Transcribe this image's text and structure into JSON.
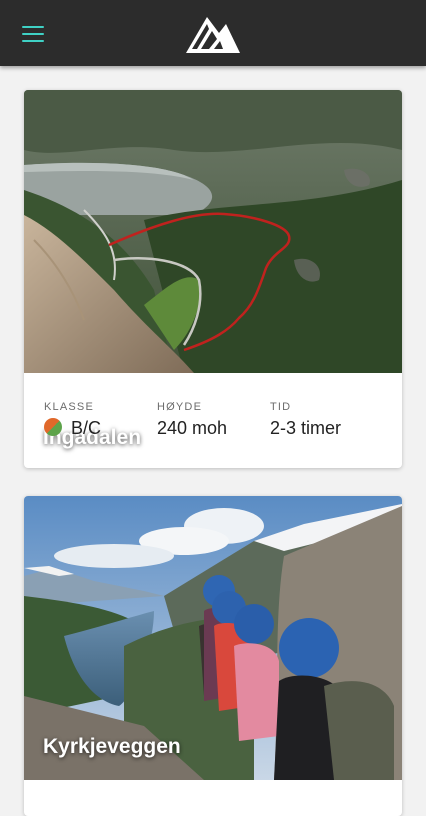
{
  "header": {
    "menu_icon": "hamburger-menu-icon",
    "logo_icon": "mountain-logo-icon",
    "accent_color": "#3fd1c5",
    "background_color": "#2c2c2c"
  },
  "routes": [
    {
      "name": "Ingadalen",
      "stats": {
        "class_label": "KLASSE",
        "class_value": "B/C",
        "height_label": "HØYDE",
        "height_value": "240 moh",
        "time_label": "TID",
        "time_value": "2-3 timer"
      }
    },
    {
      "name": "Kyrkjeveggen"
    }
  ]
}
